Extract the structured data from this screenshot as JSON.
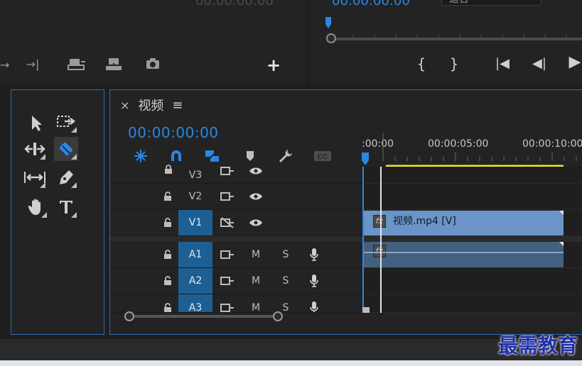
{
  "source_monitor": {
    "timecode": "00:00:00:00"
  },
  "program_monitor": {
    "timecode": "00:00:00:00",
    "fit_dropdown": "适合"
  },
  "program_controls": [
    "{",
    "}",
    "|◀",
    "◀|",
    "▶"
  ],
  "timeline": {
    "close_label": "×",
    "sequence_name": "视频",
    "menu_label": "≡",
    "timecode": "00:00:00:00",
    "ruler_labels": [
      ":00:00",
      "00:00:05:00",
      "00:00:10:00"
    ],
    "tracks": [
      {
        "name": "V3",
        "type": "video"
      },
      {
        "name": "V2",
        "type": "video"
      },
      {
        "name": "V1",
        "type": "video",
        "targeted": true
      },
      {
        "name": "A1",
        "type": "audio",
        "targeted": true
      },
      {
        "name": "A2",
        "type": "audio",
        "targeted": true
      },
      {
        "name": "A3",
        "type": "audio",
        "targeted": true
      }
    ],
    "mute_label": "M",
    "solo_label": "S",
    "video_clip_label": "视频.mp4 [V]",
    "fx_label": "fx"
  },
  "colors": {
    "accent": "#2c86e5",
    "panel_border": "#2e6ab3",
    "clip_video": "#6b95c8",
    "clip_audio": "#44607f",
    "track_target": "#1d5f93"
  },
  "watermark": "最需教育"
}
